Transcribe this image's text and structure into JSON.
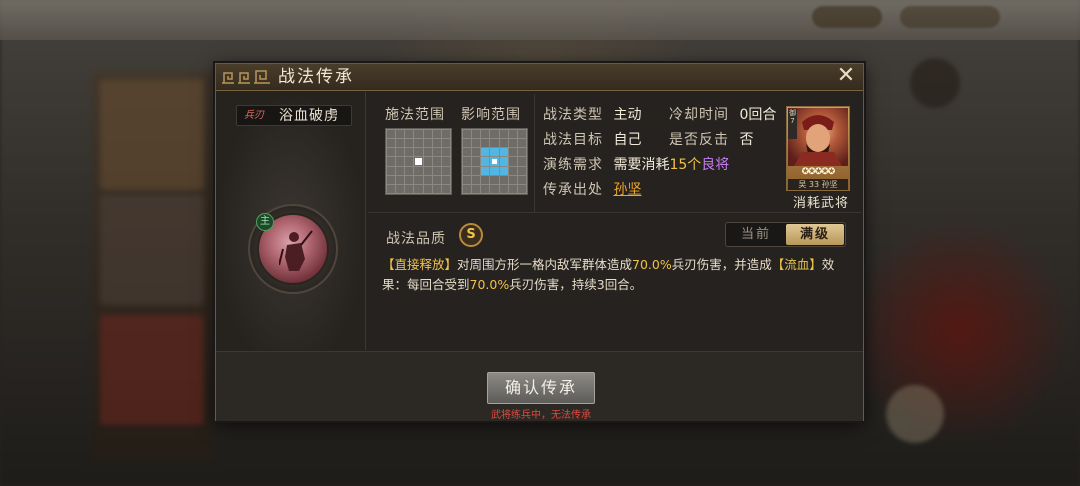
{
  "modal": {
    "title": "战法传承",
    "close_icon": "close-icon"
  },
  "skill": {
    "weapon_tag": "兵刃",
    "name": "浴血破虏",
    "main_badge": "主"
  },
  "range": {
    "cast_label": "施法范围",
    "effect_label": "影响范围"
  },
  "info": {
    "type_label": "战法类型",
    "type_value": "主动",
    "cooldown_label": "冷却时间",
    "cooldown_value": "0回合",
    "target_label": "战法目标",
    "target_value": "自己",
    "counter_label": "是否反击",
    "counter_value": "否",
    "train_label": "演练需求",
    "train_prefix": "需要消耗",
    "train_count": "15个",
    "train_item": "良将",
    "source_label": "传承出处",
    "source_value": "孙坚"
  },
  "general": {
    "side_tag": "御7",
    "stars": "✪✪✪✪✪",
    "faction": "吴",
    "cost": "33",
    "name_small": "孙坚",
    "caption": "消耗武将"
  },
  "quality": {
    "label": "战法品质",
    "grade": "S"
  },
  "level_toggle": {
    "current": "当前",
    "max": "满级",
    "selected": "满级"
  },
  "description": {
    "tag": "【直接释放】",
    "part1": "对周围方形一格内敌军群体造成",
    "pct1": "70.0%",
    "part2": "兵刃伤害，并造成",
    "status": "【流血】",
    "part3": "效果：每回合受到",
    "pct2": "70.0%",
    "part4": "兵刃伤害，持续3回合。"
  },
  "footer": {
    "confirm_label": "确认传承",
    "warning": "武将练兵中，无法传承"
  },
  "colors": {
    "accent_gold": "#f0c24b",
    "aoe_blue": "#52b6e3",
    "warning_red": "#e0483d",
    "rarity_purple": "#c77cf0"
  }
}
